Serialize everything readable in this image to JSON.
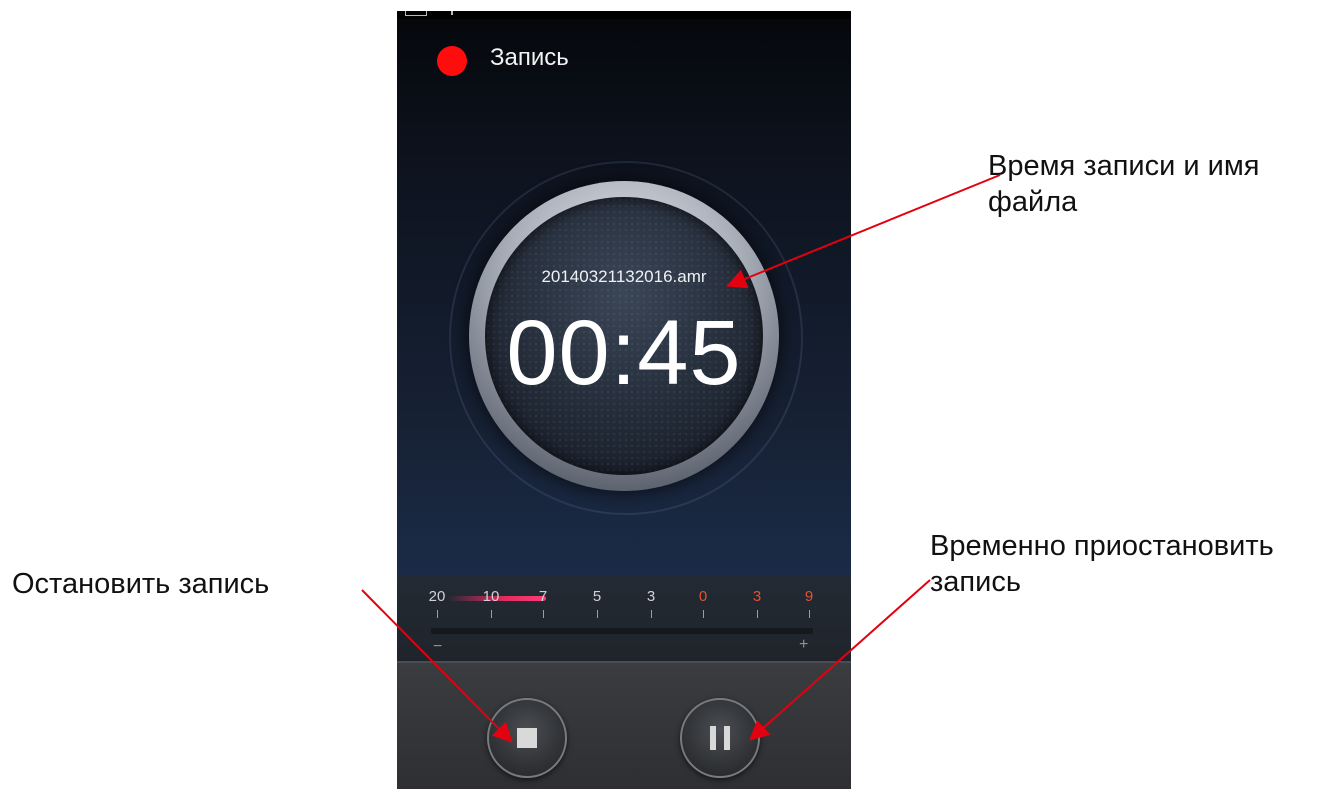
{
  "screen": {
    "title": "Запись",
    "record_indicator_color": "#ff0d0d"
  },
  "dial": {
    "filename": "20140321132016.amr",
    "elapsed": "00:45"
  },
  "level_meter": {
    "scale": [
      "20",
      "10",
      "7",
      "5",
      "3",
      "0",
      "3",
      "9"
    ],
    "scale_colors": [
      "#cfd3d8",
      "#cfd3d8",
      "#cfd3d8",
      "#cfd3d8",
      "#cfd3d8",
      "#e2532f",
      "#e2532f",
      "#e2532f"
    ],
    "minus_label": "−",
    "plus_label": "+",
    "fill_level_fraction": 0.27
  },
  "controls": {
    "stop_icon": "stop-icon",
    "pause_icon": "pause-icon"
  },
  "annotations": {
    "dial_note": "Время записи и имя файла",
    "stop_note": "Остановить запись",
    "pause_note": "Временно приостановить запись",
    "arrow_color": "#e3000f"
  }
}
